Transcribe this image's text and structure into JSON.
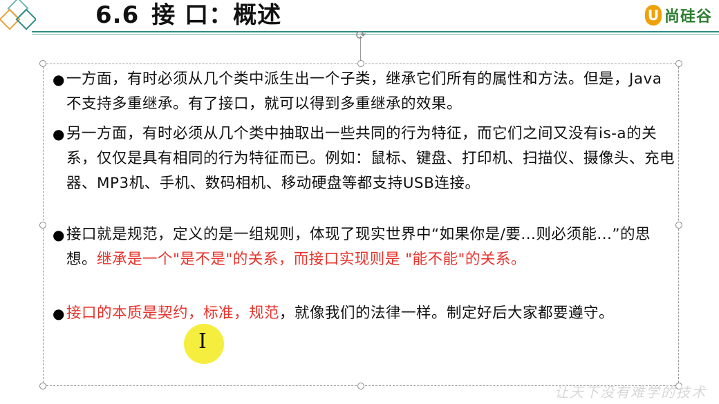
{
  "header": {
    "number": "6.6",
    "title": "接 口：概述",
    "brand_mark": "U",
    "brand_name": "尚硅谷"
  },
  "bullets": [
    {
      "segments": [
        {
          "text": "一方面，有时必须从几个类中派生出一个子类，继承它们所有的属性和方法。但是，Java不支持多重继承。有了接口，就可以得到多重继承的效果。",
          "red": false
        }
      ]
    },
    {
      "segments": [
        {
          "text": "另一方面，有时必须从几个类中抽取出一些共同的行为特征，而它们之间又没有is-a的关系，仅仅是具有相同的行为特征而已。例如：鼠标、键盘、打印机、扫描仪、摄像头、充电器、MP3机、手机、数码相机、移动硬盘等都支持USB连接。",
          "red": false
        }
      ]
    },
    {
      "segments": [
        {
          "text": "接口就是规范，定义的是一组规则，体现了现实世界中“如果你是/要...则必须能...”的思想。",
          "red": false
        },
        {
          "text": "继承是一个\"是不是\"的关系，而接口实现则是 \"能不能\"的关系。",
          "red": true
        }
      ]
    },
    {
      "segments": [
        {
          "text": " 接口的本质是契约，标准，规范",
          "red": true
        },
        {
          "text": "，就像我们的法律一样。制定好后大家都要遵守。",
          "red": false
        }
      ]
    }
  ],
  "bullet_symbol": "●",
  "cursor_symbol": "I",
  "watermark": "让天下没有难学的技术",
  "colors": {
    "accent_red": "#e8322b",
    "rule_teal": "#2d8b86",
    "brand_orange": "#f0a10a",
    "brand_green": "#2e7d32",
    "highlight_yellow": "#f5ec2a"
  }
}
